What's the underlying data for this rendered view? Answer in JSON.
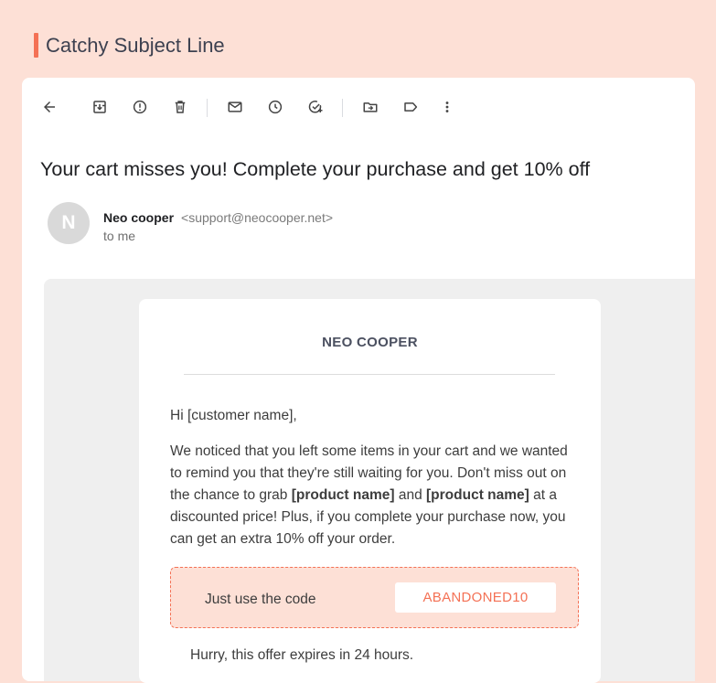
{
  "header": {
    "title": "Catchy Subject Line"
  },
  "toolbar": {
    "icons": [
      "back-arrow-icon",
      "archive-icon",
      "report-spam-icon",
      "delete-icon",
      "mark-unread-icon",
      "snooze-icon",
      "add-task-icon",
      "move-to-icon",
      "label-icon",
      "more-options-icon"
    ]
  },
  "email": {
    "subject": "Your cart misses you! Complete your purchase and get 10% off",
    "sender": {
      "initial": "N",
      "name": "Neo cooper",
      "address": "<support@neocooper.net>",
      "to": "to me"
    },
    "body": {
      "brand": "NEO COOPER",
      "greeting": "Hi [customer name],",
      "para_part1": "We noticed that you left some items in your cart and we wanted to remind you that they're still waiting for you. Don't miss out on the chance to grab ",
      "product1": "[product name]",
      "para_and": " and ",
      "product2": "[product name]",
      "para_part2": " at a discounted price! Plus, if you complete your purchase now, you can get an extra 10% off your order.",
      "code_label": "Just use the code",
      "code": "ABANDONED10",
      "hurry": "Hurry, this offer expires in 24 hours."
    }
  },
  "colors": {
    "background": "#fde0d6",
    "accent": "#f47155",
    "text": "#3d3d3d"
  }
}
